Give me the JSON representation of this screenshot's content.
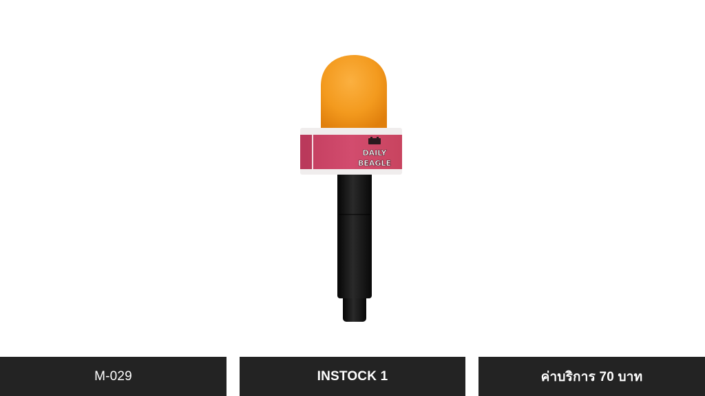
{
  "product": {
    "image_name": "microphone-icon",
    "flag_text_line1": "DAILY",
    "flag_text_line2": "BEAGLE",
    "colors": {
      "foam": "#f39a1e",
      "flag": "#d24c6e",
      "handle": "#121212"
    }
  },
  "info": {
    "code": "M-029",
    "stock": "INSTOCK 1",
    "price": "ค่าบริการ 70 บาท"
  }
}
